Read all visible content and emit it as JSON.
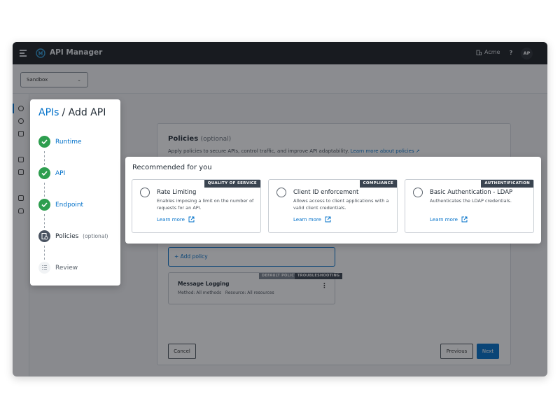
{
  "app": {
    "title": "API Manager",
    "org": "Acme",
    "help": "?",
    "avatar": "AP",
    "environment": "Sandbox"
  },
  "breadcrumb": {
    "link": "APIs",
    "current": "/ Add API"
  },
  "steps": [
    {
      "label": "Runtime",
      "state": "complete"
    },
    {
      "label": "API",
      "state": "complete"
    },
    {
      "label": "Endpoint",
      "state": "complete"
    },
    {
      "label": "Policies",
      "optional": "(optional)",
      "state": "current"
    },
    {
      "label": "Review",
      "state": "upcoming"
    }
  ],
  "policies": {
    "title": "Policies",
    "optional": "(optional)",
    "description": "Apply policies to secure APIs, control traffic, and improve API adaptability.",
    "learn_more": "Learn more about policies",
    "add_policy": "+ Add policy",
    "applied": [
      {
        "name": "Message Logging",
        "method": "Method: All methods",
        "resource": "Resource:  All resources",
        "badges": [
          "DEFAULT POLICY",
          "TROUBLESHOOTING"
        ]
      }
    ]
  },
  "buttons": {
    "cancel": "Cancel",
    "previous": "Previous",
    "next": "Next"
  },
  "recommended": {
    "title": "Recommended for you",
    "cards": [
      {
        "category": "QUALITY OF SERVICE",
        "name": "Rate Limiting",
        "description": "Enables imposing a limit on the number of requests for an API.",
        "link": "Learn more"
      },
      {
        "category": "COMPLIANCE",
        "name": "Client ID enforcement",
        "description": "Allows access to client applications with a valid client credentials.",
        "link": "Learn more"
      },
      {
        "category": "AUTHENTIFICATION",
        "name": "Basic Authentication - LDAP",
        "description": "Authenticates the LDAP credentials.",
        "link": "Learn more"
      }
    ]
  },
  "colors": {
    "accent": "#0070c9",
    "success": "#2e9e4f",
    "topbar": "#1c1f24"
  }
}
